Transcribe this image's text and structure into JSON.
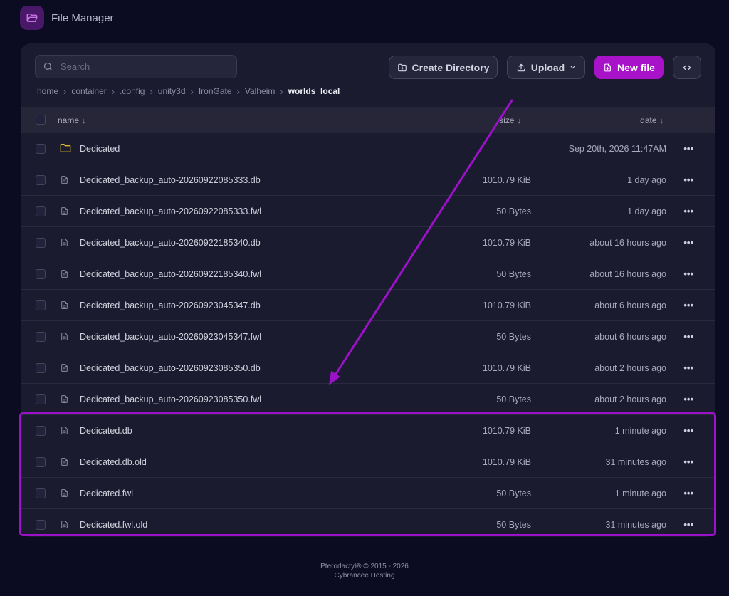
{
  "app": {
    "title": "File Manager"
  },
  "search": {
    "placeholder": "Search"
  },
  "toolbar": {
    "create_directory_label": "Create Directory",
    "upload_label": "Upload",
    "new_file_label": "New file",
    "accent_color": "#a812c9"
  },
  "breadcrumb": {
    "items": [
      "home",
      "container",
      ".config",
      "unity3d",
      "IronGate",
      "Valheim"
    ],
    "current": "worlds_local"
  },
  "table": {
    "headers": {
      "name": "name",
      "size": "size",
      "date": "date"
    },
    "rows": [
      {
        "type": "folder",
        "name": "Dedicated",
        "size": "",
        "date": "Sep 20th, 2026 11:47AM"
      },
      {
        "type": "file",
        "name": "Dedicated_backup_auto-20260922085333.db",
        "size": "1010.79 KiB",
        "date": "1 day ago"
      },
      {
        "type": "file",
        "name": "Dedicated_backup_auto-20260922085333.fwl",
        "size": "50 Bytes",
        "date": "1 day ago"
      },
      {
        "type": "file",
        "name": "Dedicated_backup_auto-20260922185340.db",
        "size": "1010.79 KiB",
        "date": "about 16 hours ago"
      },
      {
        "type": "file",
        "name": "Dedicated_backup_auto-20260922185340.fwl",
        "size": "50 Bytes",
        "date": "about 16 hours ago"
      },
      {
        "type": "file",
        "name": "Dedicated_backup_auto-20260923045347.db",
        "size": "1010.79 KiB",
        "date": "about 6 hours ago"
      },
      {
        "type": "file",
        "name": "Dedicated_backup_auto-20260923045347.fwl",
        "size": "50 Bytes",
        "date": "about 6 hours ago"
      },
      {
        "type": "file",
        "name": "Dedicated_backup_auto-20260923085350.db",
        "size": "1010.79 KiB",
        "date": "about 2 hours ago"
      },
      {
        "type": "file",
        "name": "Dedicated_backup_auto-20260923085350.fwl",
        "size": "50 Bytes",
        "date": "about 2 hours ago"
      },
      {
        "type": "file",
        "name": "Dedicated.db",
        "size": "1010.79 KiB",
        "date": "1 minute ago"
      },
      {
        "type": "file",
        "name": "Dedicated.db.old",
        "size": "1010.79 KiB",
        "date": "31 minutes ago"
      },
      {
        "type": "file",
        "name": "Dedicated.fwl",
        "size": "50 Bytes",
        "date": "1 minute ago"
      },
      {
        "type": "file",
        "name": "Dedicated.fwl.old",
        "size": "50 Bytes",
        "date": "31 minutes ago"
      }
    ],
    "more_label": "•••"
  },
  "annotation": {
    "color": "#9c12c9"
  },
  "footer": {
    "line1": "Pterodactyl® © 2015 - 2026",
    "line2": "Cybrancee Hosting"
  }
}
